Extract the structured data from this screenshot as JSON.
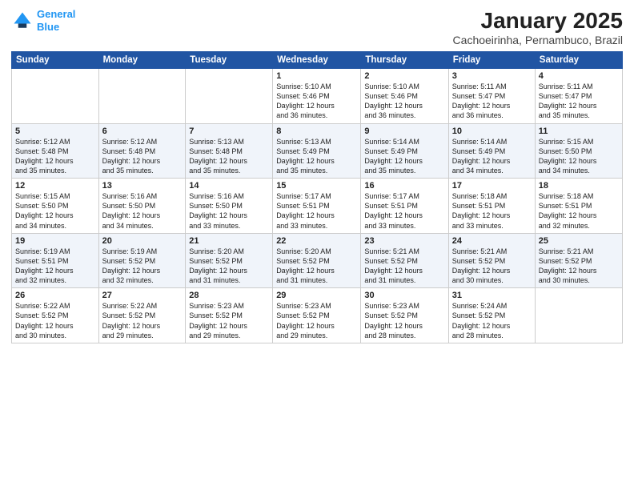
{
  "header": {
    "logo_line1": "General",
    "logo_line2": "Blue",
    "month_year": "January 2025",
    "location": "Cachoeirinha, Pernambuco, Brazil"
  },
  "days_of_week": [
    "Sunday",
    "Monday",
    "Tuesday",
    "Wednesday",
    "Thursday",
    "Friday",
    "Saturday"
  ],
  "weeks": [
    [
      {
        "num": "",
        "info": ""
      },
      {
        "num": "",
        "info": ""
      },
      {
        "num": "",
        "info": ""
      },
      {
        "num": "1",
        "info": "Sunrise: 5:10 AM\nSunset: 5:46 PM\nDaylight: 12 hours\nand 36 minutes."
      },
      {
        "num": "2",
        "info": "Sunrise: 5:10 AM\nSunset: 5:46 PM\nDaylight: 12 hours\nand 36 minutes."
      },
      {
        "num": "3",
        "info": "Sunrise: 5:11 AM\nSunset: 5:47 PM\nDaylight: 12 hours\nand 36 minutes."
      },
      {
        "num": "4",
        "info": "Sunrise: 5:11 AM\nSunset: 5:47 PM\nDaylight: 12 hours\nand 35 minutes."
      }
    ],
    [
      {
        "num": "5",
        "info": "Sunrise: 5:12 AM\nSunset: 5:48 PM\nDaylight: 12 hours\nand 35 minutes."
      },
      {
        "num": "6",
        "info": "Sunrise: 5:12 AM\nSunset: 5:48 PM\nDaylight: 12 hours\nand 35 minutes."
      },
      {
        "num": "7",
        "info": "Sunrise: 5:13 AM\nSunset: 5:48 PM\nDaylight: 12 hours\nand 35 minutes."
      },
      {
        "num": "8",
        "info": "Sunrise: 5:13 AM\nSunset: 5:49 PM\nDaylight: 12 hours\nand 35 minutes."
      },
      {
        "num": "9",
        "info": "Sunrise: 5:14 AM\nSunset: 5:49 PM\nDaylight: 12 hours\nand 35 minutes."
      },
      {
        "num": "10",
        "info": "Sunrise: 5:14 AM\nSunset: 5:49 PM\nDaylight: 12 hours\nand 34 minutes."
      },
      {
        "num": "11",
        "info": "Sunrise: 5:15 AM\nSunset: 5:50 PM\nDaylight: 12 hours\nand 34 minutes."
      }
    ],
    [
      {
        "num": "12",
        "info": "Sunrise: 5:15 AM\nSunset: 5:50 PM\nDaylight: 12 hours\nand 34 minutes."
      },
      {
        "num": "13",
        "info": "Sunrise: 5:16 AM\nSunset: 5:50 PM\nDaylight: 12 hours\nand 34 minutes."
      },
      {
        "num": "14",
        "info": "Sunrise: 5:16 AM\nSunset: 5:50 PM\nDaylight: 12 hours\nand 33 minutes."
      },
      {
        "num": "15",
        "info": "Sunrise: 5:17 AM\nSunset: 5:51 PM\nDaylight: 12 hours\nand 33 minutes."
      },
      {
        "num": "16",
        "info": "Sunrise: 5:17 AM\nSunset: 5:51 PM\nDaylight: 12 hours\nand 33 minutes."
      },
      {
        "num": "17",
        "info": "Sunrise: 5:18 AM\nSunset: 5:51 PM\nDaylight: 12 hours\nand 33 minutes."
      },
      {
        "num": "18",
        "info": "Sunrise: 5:18 AM\nSunset: 5:51 PM\nDaylight: 12 hours\nand 32 minutes."
      }
    ],
    [
      {
        "num": "19",
        "info": "Sunrise: 5:19 AM\nSunset: 5:51 PM\nDaylight: 12 hours\nand 32 minutes."
      },
      {
        "num": "20",
        "info": "Sunrise: 5:19 AM\nSunset: 5:52 PM\nDaylight: 12 hours\nand 32 minutes."
      },
      {
        "num": "21",
        "info": "Sunrise: 5:20 AM\nSunset: 5:52 PM\nDaylight: 12 hours\nand 31 minutes."
      },
      {
        "num": "22",
        "info": "Sunrise: 5:20 AM\nSunset: 5:52 PM\nDaylight: 12 hours\nand 31 minutes."
      },
      {
        "num": "23",
        "info": "Sunrise: 5:21 AM\nSunset: 5:52 PM\nDaylight: 12 hours\nand 31 minutes."
      },
      {
        "num": "24",
        "info": "Sunrise: 5:21 AM\nSunset: 5:52 PM\nDaylight: 12 hours\nand 30 minutes."
      },
      {
        "num": "25",
        "info": "Sunrise: 5:21 AM\nSunset: 5:52 PM\nDaylight: 12 hours\nand 30 minutes."
      }
    ],
    [
      {
        "num": "26",
        "info": "Sunrise: 5:22 AM\nSunset: 5:52 PM\nDaylight: 12 hours\nand 30 minutes."
      },
      {
        "num": "27",
        "info": "Sunrise: 5:22 AM\nSunset: 5:52 PM\nDaylight: 12 hours\nand 29 minutes."
      },
      {
        "num": "28",
        "info": "Sunrise: 5:23 AM\nSunset: 5:52 PM\nDaylight: 12 hours\nand 29 minutes."
      },
      {
        "num": "29",
        "info": "Sunrise: 5:23 AM\nSunset: 5:52 PM\nDaylight: 12 hours\nand 29 minutes."
      },
      {
        "num": "30",
        "info": "Sunrise: 5:23 AM\nSunset: 5:52 PM\nDaylight: 12 hours\nand 28 minutes."
      },
      {
        "num": "31",
        "info": "Sunrise: 5:24 AM\nSunset: 5:52 PM\nDaylight: 12 hours\nand 28 minutes."
      },
      {
        "num": "",
        "info": ""
      }
    ]
  ]
}
